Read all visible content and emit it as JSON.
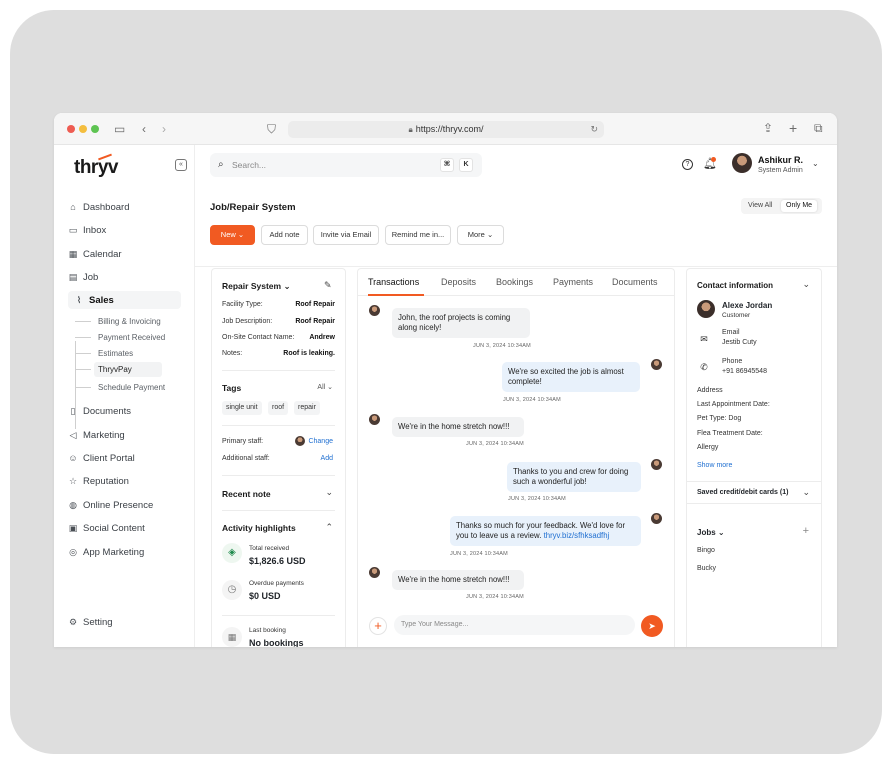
{
  "browser": {
    "url": "https://thryv.com/"
  },
  "app": {
    "logo": "thryv"
  },
  "sidebar": {
    "items": [
      {
        "label": "Dashboard",
        "icon": "home-icon"
      },
      {
        "label": "Inbox",
        "icon": "inbox-icon"
      },
      {
        "label": "Calendar",
        "icon": "calendar-icon"
      },
      {
        "label": "Job",
        "icon": "job-icon"
      },
      {
        "label": "Sales",
        "icon": "chart-icon"
      },
      {
        "label": "Documents",
        "icon": "document-icon"
      },
      {
        "label": "Marketing",
        "icon": "megaphone-icon"
      },
      {
        "label": "Client Portal",
        "icon": "users-icon"
      },
      {
        "label": "Reputation",
        "icon": "star-icon"
      },
      {
        "label": "Online Presence",
        "icon": "globe-icon"
      },
      {
        "label": "Social Content",
        "icon": "social-icon"
      },
      {
        "label": "App Marketing",
        "icon": "target-icon"
      }
    ],
    "sales_sub": [
      "Billing & Invoicing",
      "Payment Received",
      "Estimates",
      "ThryvPay",
      "Schedule Payment"
    ],
    "setting": "Setting"
  },
  "topbar": {
    "search_placeholder": "Search...",
    "shortcut_cmd": "⌘",
    "shortcut_key": "K",
    "user_name": "Ashikur R.",
    "user_role": "System Admin"
  },
  "page": {
    "title": "Job/Repair System",
    "view_all": "View All",
    "only_me": "Only Me",
    "actions": {
      "new": "New",
      "add_note": "Add note",
      "invite": "Invite via Email",
      "remind": "Remind me in...",
      "more": "More"
    }
  },
  "details": {
    "title": "Repair System",
    "rows": [
      {
        "label": "Facility Type:",
        "value": "Roof Repair"
      },
      {
        "label": "Job Description:",
        "value": "Roof Repair"
      },
      {
        "label": "On-Site Contact Name:",
        "value": "Andrew"
      },
      {
        "label": "Notes:",
        "value": "Roof is leaking."
      }
    ],
    "tags_title": "Tags",
    "tags_filter": "All",
    "tags": [
      "single unit",
      "roof",
      "repair"
    ],
    "primary_staff_label": "Primary staff:",
    "primary_staff_action": "Change",
    "additional_staff_label": "Additional staff:",
    "additional_staff_action": "Add",
    "recent_note": "Recent note",
    "activity_title": "Activity highlights",
    "activity": [
      {
        "label": "Total received",
        "value": "$1,826.6 USD"
      },
      {
        "label": "Overdue payments",
        "value": "$0 USD"
      },
      {
        "label": "Last booking",
        "value": "No bookings"
      }
    ]
  },
  "chat": {
    "tabs": [
      "Transactions",
      "Deposits",
      "Bookings",
      "Payments",
      "Documents"
    ],
    "messages": [
      {
        "dir": "in",
        "text": "John, the roof projects is coming along nicely!",
        "time": "JUN 3, 2024 10:34AM"
      },
      {
        "dir": "out",
        "text": "We're so excited the job is almost complete!",
        "time": "JUN 3, 2024 10:34AM"
      },
      {
        "dir": "in",
        "text": "We're in the home stretch now!!!",
        "time": "JUN 3, 2024 10:34AM"
      },
      {
        "dir": "out",
        "text": "Thanks to you and crew for doing such a wonderful job!",
        "time": "JUN 3, 2024 10:34AM"
      },
      {
        "dir": "out",
        "text": "Thanks so much for your feedback. We'd love for you to leave us a review.",
        "link": "thryv.biz/sfhksadfhj",
        "time": "JUN 3, 2024 10:34AM"
      },
      {
        "dir": "in",
        "text": "We're in the home stretch now!!!",
        "time": "JUN 3, 2024 10:34AM"
      }
    ],
    "composer_placeholder": "Type Your Message..."
  },
  "contact": {
    "title": "Contact information",
    "name": "Alexe Jordan",
    "role": "Customer",
    "email_label": "Email",
    "email_value": "Jestib Cuty",
    "phone_label": "Phone",
    "phone_value": "+91 86945548",
    "fields": [
      "Address",
      "Last Appointment Date:",
      "Pet Type: Dog",
      "Flea Treatment Date:",
      "Allergy"
    ],
    "show_more": "Show more",
    "saved_cards": "Saved credit/debit cards (1)",
    "jobs_title": "Jobs",
    "jobs": [
      "Bingo",
      "Bucky"
    ]
  },
  "colors": {
    "accent": "#f15a22",
    "link": "#1f6fd1"
  }
}
